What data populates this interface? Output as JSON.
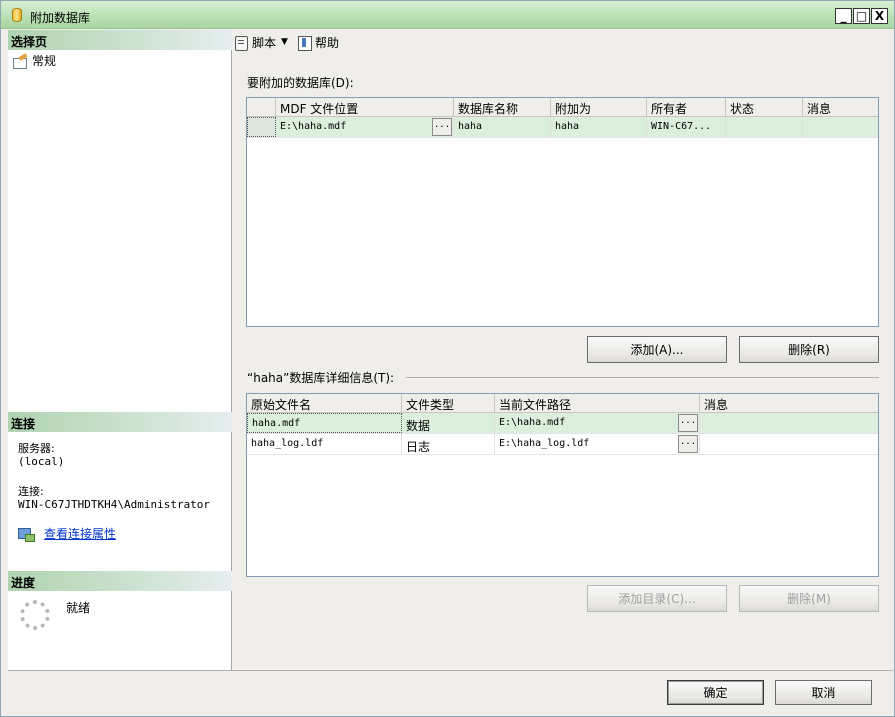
{
  "window": {
    "title": "附加数据库",
    "controls": [
      "_",
      "□",
      "X"
    ]
  },
  "left": {
    "select_page_header": "选择页",
    "general_item": "常规",
    "connection_header": "连接",
    "server_label": "服务器:",
    "server_value": "(local)",
    "connection_label": "连接:",
    "connection_value": "WIN-C67JTHDTKH4\\Administrator",
    "view_props_link": "查看连接属性",
    "progress_header": "进度",
    "progress_status": "就绪"
  },
  "toolbar": {
    "script_label": "脚本",
    "help_label": "帮助"
  },
  "databases": {
    "group_label": "要附加的数据库(D):",
    "columns": [
      "MDF 文件位置",
      "数据库名称",
      "附加为",
      "所有者",
      "状态",
      "消息"
    ],
    "rows": [
      {
        "mdf": "E:\\haha.mdf",
        "db_name": "haha",
        "attach_as": "haha",
        "owner": "WIN-C67...",
        "status": "",
        "message": ""
      }
    ],
    "add_button": "添加(A)...",
    "remove_button": "删除(R)"
  },
  "details": {
    "group_label": "“haha”数据库详细信息(T):",
    "columns": [
      "原始文件名",
      "文件类型",
      "当前文件路径",
      "消息"
    ],
    "rows": [
      {
        "original": "haha.mdf",
        "type": "数据",
        "path": "E:\\haha.mdf",
        "message": ""
      },
      {
        "original": "haha_log.ldf",
        "type": "日志",
        "path": "E:\\haha_log.ldf",
        "message": ""
      }
    ],
    "add_catalog_button": "添加目录(C)...",
    "remove_button": "删除(M)"
  },
  "footer": {
    "ok_button": "确定",
    "cancel_button": "取消"
  }
}
